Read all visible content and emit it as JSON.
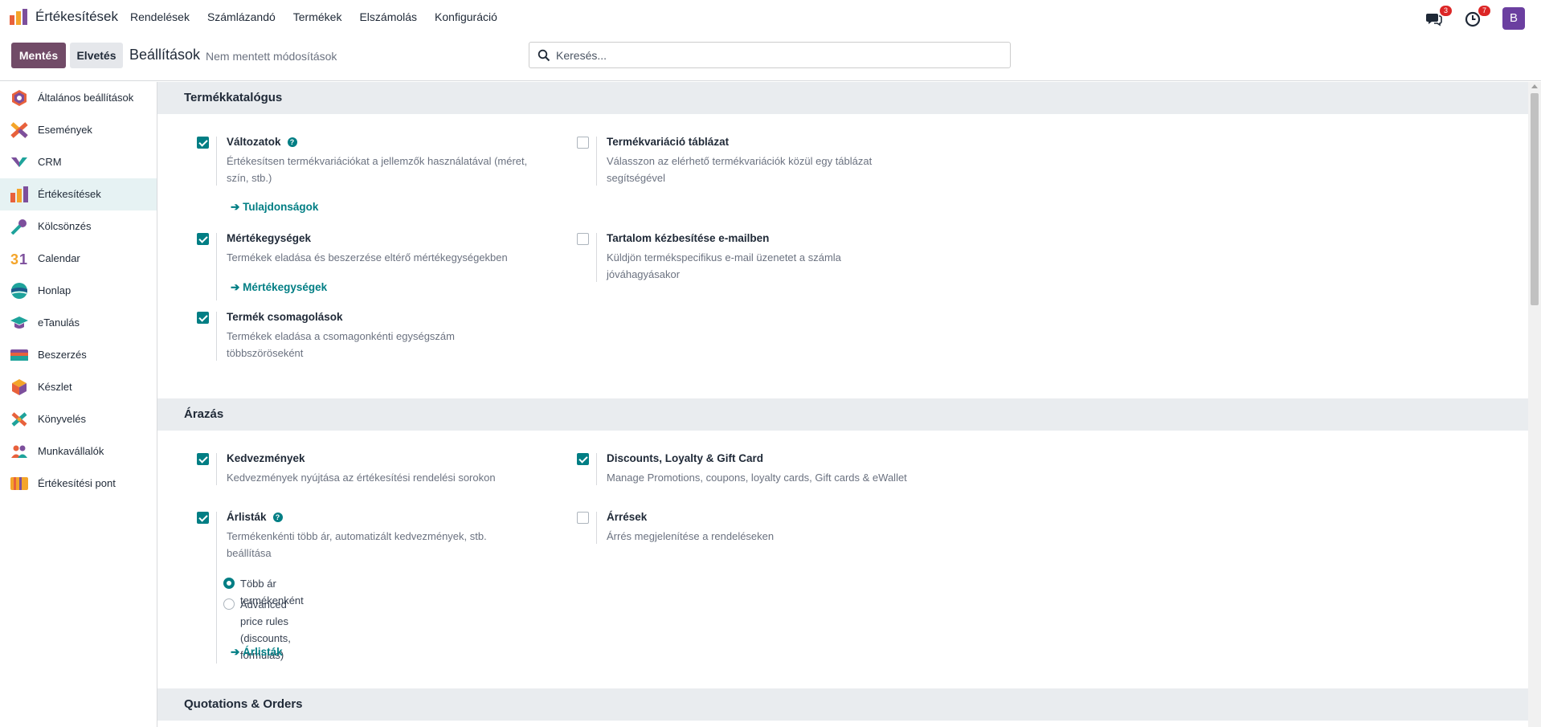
{
  "navbar": {
    "app_name": "Értékesítések",
    "menu": [
      "Rendelések",
      "Számlázandó",
      "Termékek",
      "Elszámolás",
      "Konfiguráció"
    ],
    "messages_count": "3",
    "activities_count": "7",
    "avatar_letter": "B"
  },
  "control_panel": {
    "save_label": "Mentés",
    "discard_label": "Elvetés",
    "title": "Beállítások",
    "unsaved": "Nem mentett módosítások",
    "search_placeholder": "Keresés..."
  },
  "sidebar": {
    "items": [
      {
        "label": "Általános beállítások",
        "icon": "general-settings-icon"
      },
      {
        "label": "Események",
        "icon": "events-icon"
      },
      {
        "label": "CRM",
        "icon": "crm-icon"
      },
      {
        "label": "Értékesítések",
        "icon": "sales-icon",
        "active": true
      },
      {
        "label": "Kölcsönzés",
        "icon": "rental-icon"
      },
      {
        "label": "Calendar",
        "icon": "calendar-icon"
      },
      {
        "label": "Honlap",
        "icon": "website-icon"
      },
      {
        "label": "eTanulás",
        "icon": "elearning-icon"
      },
      {
        "label": "Beszerzés",
        "icon": "purchase-icon"
      },
      {
        "label": "Készlet",
        "icon": "inventory-icon"
      },
      {
        "label": "Könyvelés",
        "icon": "accounting-icon"
      },
      {
        "label": "Munkavállalók",
        "icon": "employees-icon"
      },
      {
        "label": "Értékesítési pont",
        "icon": "point-of-sale-icon"
      }
    ]
  },
  "sections": {
    "catalog": {
      "title": "Termékkatalógus",
      "variants": {
        "title": "Változatok",
        "desc1": "Értékesítsen termékvariációkat a jellemzők használatával (méret,",
        "desc2": "szín, stb.)",
        "link": "Tulajdonságok",
        "checked": true
      },
      "variant_grid": {
        "title": "Termékvariáció táblázat",
        "desc1": "Válasszon az elérhető termékvariációk közül egy táblázat",
        "desc2": "segítségével",
        "checked": false
      },
      "uom": {
        "title": "Mértékegységek",
        "desc1": "Termékek eladása és beszerzése eltérő mértékegységekben",
        "link": "Mértékegységek",
        "checked": true
      },
      "email_delivery": {
        "title": "Tartalom kézbesítése e-mailben",
        "desc1": "Küldjön termékspecifikus e-mail üzenetet a számla",
        "desc2": "jóváhagyásakor",
        "checked": false
      },
      "packaging": {
        "title": "Termék csomagolások",
        "desc1": "Termékek eladása a csomagonkénti egységszám",
        "desc2": "többszöröseként",
        "checked": true
      }
    },
    "pricing": {
      "title": "Árazás",
      "discounts": {
        "title": "Kedvezmények",
        "desc1": "Kedvezmények nyújtása az értékesítési rendelési sorokon",
        "checked": true
      },
      "loyalty": {
        "title": "Discounts, Loyalty & Gift Card",
        "desc1": "Manage Promotions, coupons, loyalty cards, Gift cards & eWallet",
        "checked": true
      },
      "pricelists": {
        "title": "Árlisták",
        "desc1": "Termékenkénti több ár, automatizált kedvezmények, stb.",
        "desc2": "beállítása",
        "option1": "Több ár termékenként",
        "option2a": "Advanced price rules",
        "option2b": "(discounts, formulas)",
        "link": "Árlisták",
        "checked": true
      },
      "margins": {
        "title": "Árrések",
        "desc1": "Árrés megjelenítése a rendeléseken",
        "checked": false
      }
    },
    "quotations": {
      "title": "Quotations & Orders"
    }
  }
}
